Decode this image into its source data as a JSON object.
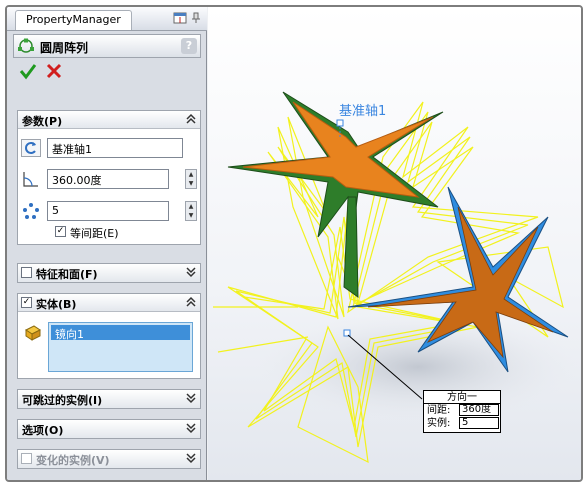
{
  "panel": {
    "tab_label": "PropertyManager",
    "feature_title": "圆周阵列",
    "help_label": "?"
  },
  "groups": {
    "params": {
      "title": "参数(P)",
      "axis_value": "基准轴1",
      "angle_value": "360.00度",
      "count_value": "5",
      "equal_spacing_label": "等间距(E)",
      "equal_spacing_checked": true
    },
    "features_faces": {
      "title": "特征和面(F)"
    },
    "bodies": {
      "title": "实体(B)",
      "selected_body": "镜向1"
    },
    "skip_instances": {
      "title": "可跳过的实例(I)"
    },
    "options": {
      "title": "选项(O)"
    },
    "varied_instances": {
      "title": "变化的实例(V)"
    }
  },
  "graphics": {
    "axis_label": "基准轴1",
    "callout": {
      "title": "方向一",
      "spacing_label": "间距:",
      "spacing_value": "360度",
      "instances_label": "实例:",
      "instances_value": "5"
    }
  },
  "colors": {
    "accent_blue": "#3e8fd9",
    "preview_yellow": "#f2f21e",
    "body_green": "#2e7d2a",
    "body_orange": "#e8831e",
    "body_blue": "#2f8de0"
  }
}
